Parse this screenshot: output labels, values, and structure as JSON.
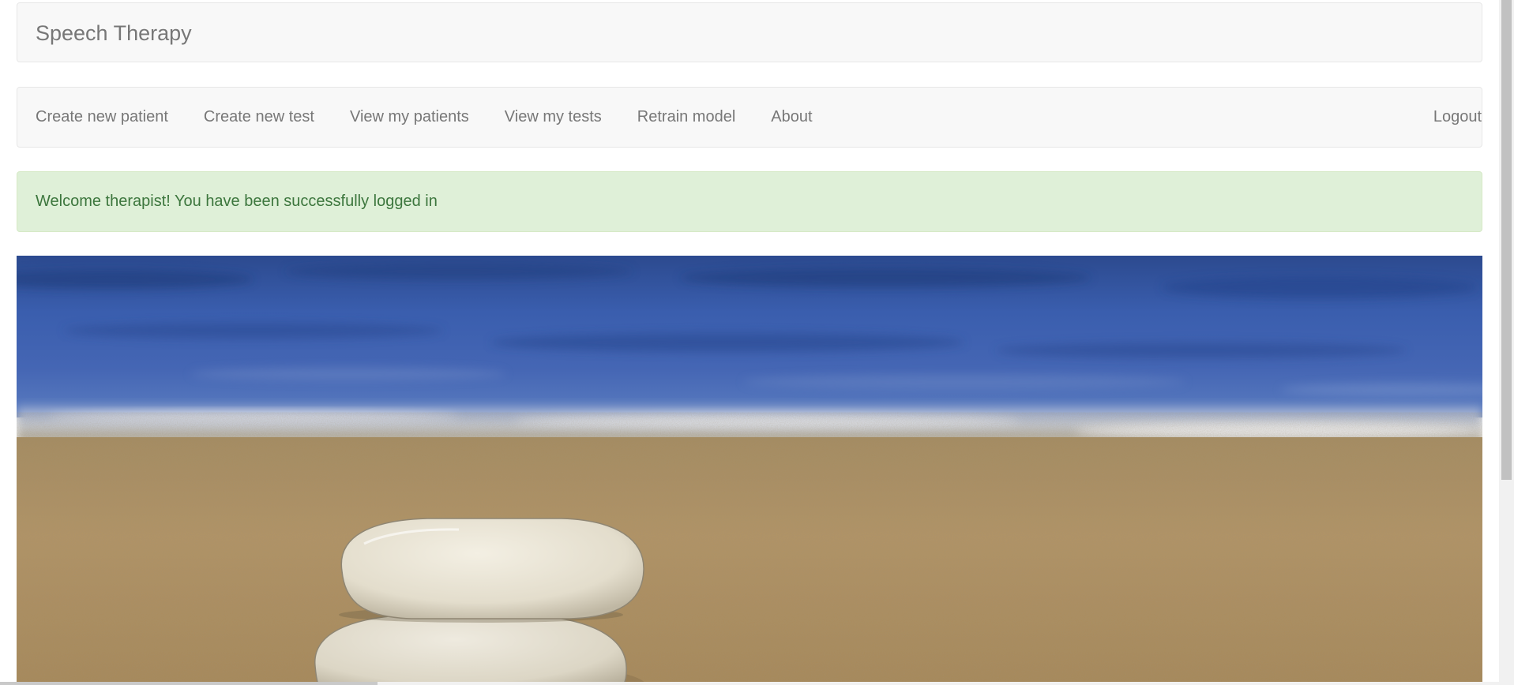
{
  "header": {
    "brand": "Speech Therapy"
  },
  "nav": {
    "items": [
      {
        "label": "Create new patient"
      },
      {
        "label": "Create new test"
      },
      {
        "label": "View my patients"
      },
      {
        "label": "View my tests"
      },
      {
        "label": "Retrain model"
      },
      {
        "label": "About"
      }
    ],
    "logout": "Logout"
  },
  "alert": {
    "message": "Welcome therapist! You have been successfully logged in",
    "type": "success"
  },
  "hero": {
    "subject": "stacked pebbles on a sandy beach with the sea behind"
  },
  "colors": {
    "navbar_bg": "#f8f8f8",
    "nav_text": "#777777",
    "alert_bg": "#dff0d8",
    "alert_text": "#3c763d",
    "sea": "#3c5faa",
    "sand": "#b39463"
  }
}
